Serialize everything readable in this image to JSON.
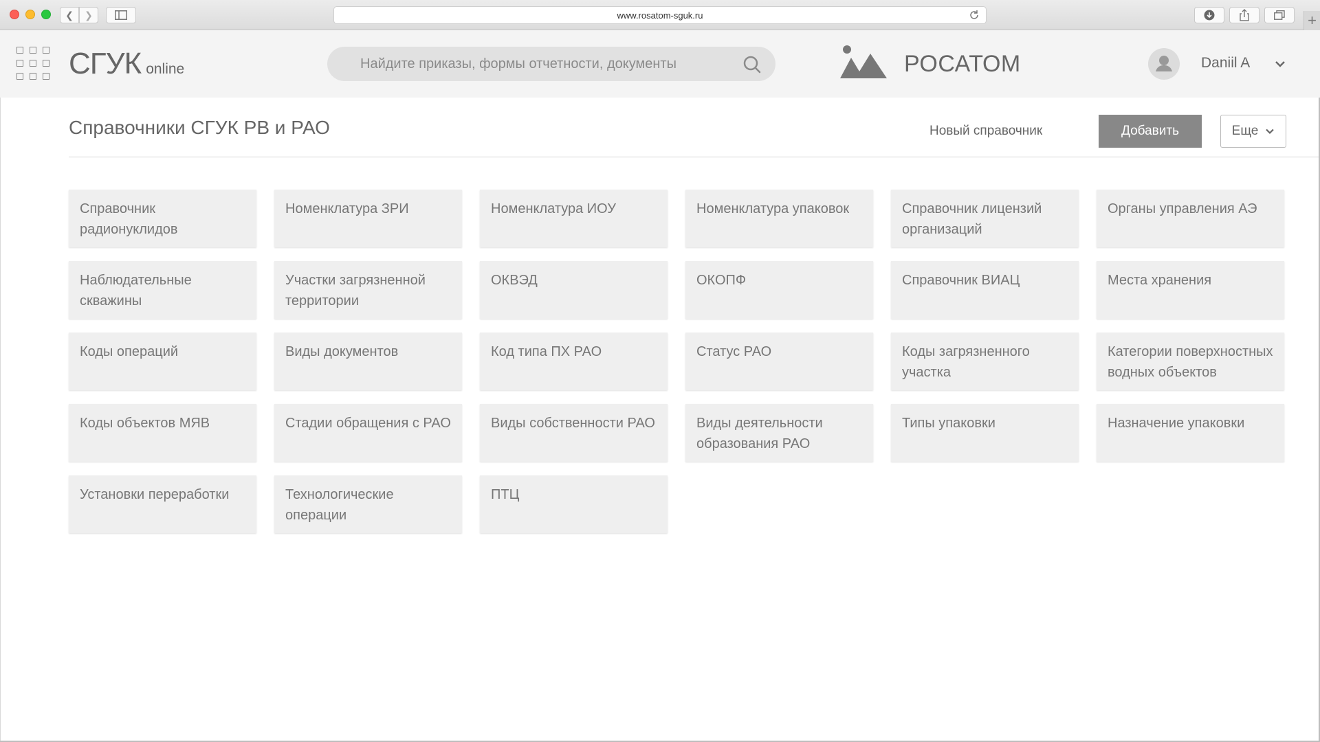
{
  "browser": {
    "url": "www.rosatom-sguk.ru"
  },
  "header": {
    "logo_main": "СГУК",
    "logo_sub": "online",
    "search_placeholder": "Найдите приказы, формы отчетности, документы",
    "brand_name": "РОСАТОМ",
    "user_name": "Daniil A"
  },
  "page": {
    "title": "Справочники СГУК РВ и РАО",
    "new_link": "Новый справочник",
    "add_label": "Добавить",
    "more_label": "Еще"
  },
  "cards": [
    "Справочник радионуклидов",
    "Номенклатура ЗРИ",
    "Номенклатура ИОУ",
    "Номенклатура упаковок",
    "Справочник лицензий организаций",
    "Органы управления АЭ",
    "Наблюдательные скважины",
    "Участки загрязненной территории",
    "ОКВЭД",
    "ОКОПФ",
    "Справочник ВИАЦ",
    "Места хранения",
    "Коды операций",
    "Виды документов",
    "Код типа ПХ РАО",
    "Статус РАО",
    "Коды загрязненного участка",
    "Категории поверхностных водных объектов",
    "Коды объектов МЯВ",
    "Стадии обращения с РАО",
    "Виды собственности РАО",
    "Виды деятельности образования РАО",
    "Типы упаковки",
    "Назначение упаковки",
    "Установки переработки",
    "Технологические операции",
    "ПТЦ"
  ]
}
